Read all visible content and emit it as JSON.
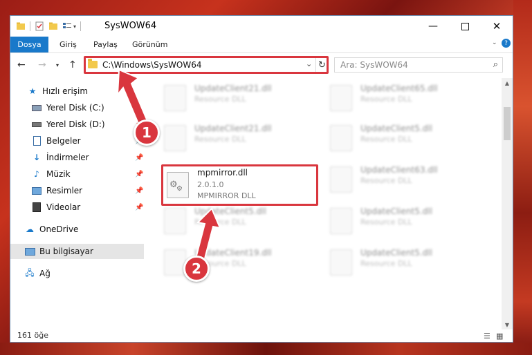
{
  "window": {
    "title": "SysWOW64"
  },
  "ribbon": {
    "tabs": [
      "Dosya",
      "Giriş",
      "Paylaş",
      "Görünüm"
    ]
  },
  "address": {
    "path": "C:\\Windows\\SysWOW64"
  },
  "search": {
    "placeholder": "Ara: SysWOW64"
  },
  "sidebar": {
    "items": [
      {
        "label": "Hızlı erişim",
        "icon": "star-icon"
      },
      {
        "label": "Yerel Disk (C:)",
        "icon": "drive-icon"
      },
      {
        "label": "Yerel Disk (D:)",
        "icon": "drive-icon"
      },
      {
        "label": "Belgeler",
        "icon": "document-icon"
      },
      {
        "label": "İndirmeler",
        "icon": "download-icon"
      },
      {
        "label": "Müzik",
        "icon": "music-icon"
      },
      {
        "label": "Resimler",
        "icon": "picture-icon"
      },
      {
        "label": "Videolar",
        "icon": "video-icon"
      },
      {
        "label": "OneDrive",
        "icon": "cloud-icon"
      },
      {
        "label": "Bu bilgisayar",
        "icon": "computer-icon"
      },
      {
        "label": "Ağ",
        "icon": "network-icon"
      }
    ]
  },
  "files": {
    "blurred": [
      {
        "name": "UpdateClient21.dll",
        "desc": "Resource DLL"
      },
      {
        "name": "UpdateClient65.dll",
        "desc": "Resource DLL"
      },
      {
        "name": "UpdateClient21.dll",
        "desc": "Resource DLL"
      },
      {
        "name": "UpdateClient5.dll",
        "desc": "Resource DLL"
      },
      {
        "name": "UpdateClient63.dll",
        "desc": "Resource DLL"
      },
      {
        "name": "UpdateClient5.dll",
        "desc": "Resource DLL"
      },
      {
        "name": "UpdateClient5.dll",
        "desc": "Resource DLL"
      },
      {
        "name": "UpdateClient19.dll",
        "desc": "Resource DLL"
      },
      {
        "name": "UpdateClient5.dll",
        "desc": "Resource DLL"
      }
    ],
    "focused": {
      "name": "mpmirror.dll",
      "version": "2.0.1.0",
      "desc": "MPMIRROR DLL"
    }
  },
  "status": {
    "count": "161 öğe"
  },
  "annotations": {
    "step1": "1",
    "step2": "2"
  },
  "colors": {
    "accent": "#1979ca",
    "highlight": "#d9363e"
  }
}
